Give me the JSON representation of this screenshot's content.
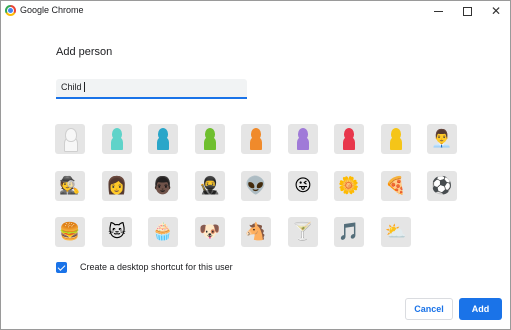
{
  "window": {
    "title": "Google Chrome"
  },
  "dialog": {
    "title": "Add person",
    "name_value": "Child",
    "shortcut_checked": true,
    "shortcut_label": "Create a desktop shortcut for this user",
    "cancel_label": "Cancel",
    "add_label": "Add"
  },
  "avatars": [
    {
      "name": "avatar-silhouette-white",
      "color": "#f7f7f7",
      "icon": "person-silhouette"
    },
    {
      "name": "avatar-silhouette-teal",
      "color": "#5fd3c9",
      "icon": "person-silhouette"
    },
    {
      "name": "avatar-silhouette-blue",
      "color": "#2aa6c9",
      "icon": "person-silhouette"
    },
    {
      "name": "avatar-silhouette-green",
      "color": "#6fbf2f",
      "icon": "person-silhouette"
    },
    {
      "name": "avatar-silhouette-orange",
      "color": "#f08a2b",
      "icon": "person-silhouette"
    },
    {
      "name": "avatar-silhouette-purple",
      "color": "#a07ad8",
      "icon": "person-silhouette"
    },
    {
      "name": "avatar-silhouette-red",
      "color": "#e8374c",
      "icon": "person-silhouette"
    },
    {
      "name": "avatar-silhouette-yellow",
      "color": "#f5c518",
      "icon": "person-silhouette"
    },
    {
      "name": "avatar-businessman",
      "glyph": "👨‍💼",
      "icon": "businessman"
    },
    {
      "name": "avatar-ninja-blond",
      "glyph": "🕵",
      "icon": "spy"
    },
    {
      "name": "avatar-woman-sunglasses",
      "glyph": "👩",
      "icon": "woman"
    },
    {
      "name": "avatar-man-dark",
      "glyph": "👨🏿",
      "icon": "man"
    },
    {
      "name": "avatar-ninja",
      "glyph": "🥷",
      "icon": "ninja"
    },
    {
      "name": "avatar-alien",
      "glyph": "👽",
      "icon": "alien"
    },
    {
      "name": "avatar-smiley",
      "glyph": "😜",
      "icon": "smiley"
    },
    {
      "name": "avatar-flower",
      "glyph": "🌼",
      "icon": "flower"
    },
    {
      "name": "avatar-pizza",
      "glyph": "🍕",
      "icon": "pizza"
    },
    {
      "name": "avatar-soccer-ball",
      "glyph": "⚽",
      "icon": "soccer-ball"
    },
    {
      "name": "avatar-burger",
      "glyph": "🍔",
      "icon": "burger"
    },
    {
      "name": "avatar-cat",
      "glyph": "🐱",
      "icon": "cat"
    },
    {
      "name": "avatar-cupcake",
      "glyph": "🧁",
      "icon": "cupcake"
    },
    {
      "name": "avatar-dog",
      "glyph": "🐶",
      "icon": "dog"
    },
    {
      "name": "avatar-horse",
      "glyph": "🐴",
      "icon": "horse"
    },
    {
      "name": "avatar-cocktail",
      "glyph": "🍸",
      "icon": "cocktail"
    },
    {
      "name": "avatar-music-note",
      "glyph": "🎵",
      "icon": "music-note"
    },
    {
      "name": "avatar-sun-cloud",
      "glyph": "⛅",
      "icon": "sun-cloud"
    }
  ]
}
